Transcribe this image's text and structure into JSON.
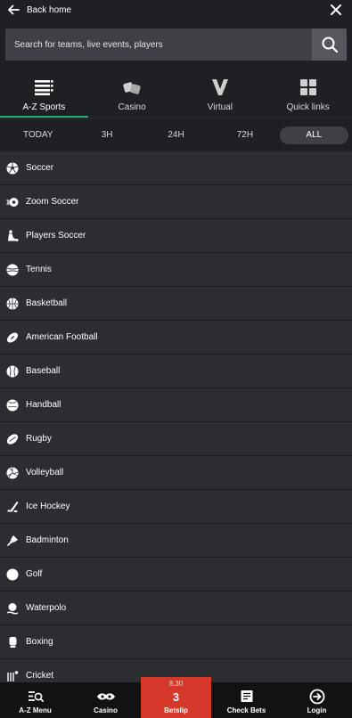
{
  "header": {
    "back_label": "Back home",
    "close_icon": "close-icon"
  },
  "search": {
    "placeholder": "Search for teams, live events, players"
  },
  "category_tabs": [
    {
      "label": "A-Z Sports",
      "icon": "list-icon",
      "active": true
    },
    {
      "label": "Casino",
      "icon": "dice-icon",
      "active": false
    },
    {
      "label": "Virtual",
      "icon": "virtual-v-icon",
      "active": false
    },
    {
      "label": "Quick links",
      "icon": "grid-icon",
      "active": false
    }
  ],
  "time_filters": [
    {
      "label": "TODAY",
      "active": false
    },
    {
      "label": "3H",
      "active": false
    },
    {
      "label": "24H",
      "active": false
    },
    {
      "label": "72H",
      "active": false
    },
    {
      "label": "ALL",
      "active": true
    }
  ],
  "sports": [
    {
      "label": "Soccer",
      "icon": "soccer-ball-icon"
    },
    {
      "label": "Zoom Soccer",
      "icon": "zoom-soccer-icon"
    },
    {
      "label": "Players Soccer",
      "icon": "players-soccer-icon"
    },
    {
      "label": "Tennis",
      "icon": "tennis-ball-icon"
    },
    {
      "label": "Basketball",
      "icon": "basketball-icon"
    },
    {
      "label": "American Football",
      "icon": "american-football-icon"
    },
    {
      "label": "Baseball",
      "icon": "baseball-icon"
    },
    {
      "label": "Handball",
      "icon": "handball-icon"
    },
    {
      "label": "Rugby",
      "icon": "rugby-ball-icon"
    },
    {
      "label": "Volleyball",
      "icon": "volleyball-icon"
    },
    {
      "label": "Ice Hockey",
      "icon": "ice-hockey-icon"
    },
    {
      "label": "Badminton",
      "icon": "badminton-icon"
    },
    {
      "label": "Golf",
      "icon": "golf-ball-icon"
    },
    {
      "label": "Waterpolo",
      "icon": "waterpolo-icon"
    },
    {
      "label": "Boxing",
      "icon": "boxing-glove-icon"
    },
    {
      "label": "Cricket",
      "icon": "cricket-icon"
    }
  ],
  "bottom_nav": {
    "az_menu": "A-Z Menu",
    "casino": "Casino",
    "betslip": {
      "odds": "8.30",
      "count": "3",
      "label": "Betslip"
    },
    "check_bets": "Check Bets",
    "login": "Login"
  },
  "colors": {
    "accent_green": "#26a96b",
    "betslip_red": "#d5382b",
    "background": "#2b2d31",
    "header_bg": "#1f2024"
  }
}
